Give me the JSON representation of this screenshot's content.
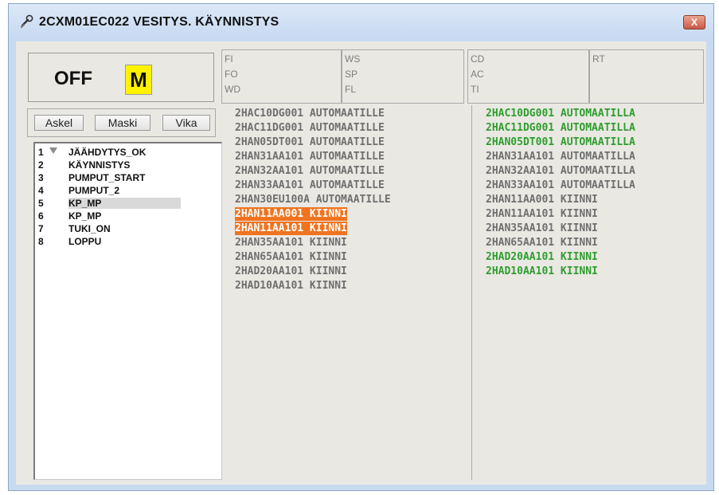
{
  "window": {
    "title": "2CXM01EC022 VESITYS. KÄYNNISTYS",
    "close_label": "X"
  },
  "status": {
    "state": "OFF",
    "mode": "M",
    "mode_color": "#fff200"
  },
  "params": [
    [
      "FI",
      "FO",
      "WD"
    ],
    [
      "WS",
      "SP",
      "FL"
    ],
    [
      "CD",
      "AC",
      "TI"
    ],
    [
      "RT"
    ]
  ],
  "buttons": {
    "step": "Askel",
    "mask": "Maski",
    "fault": "Vika"
  },
  "steps": [
    {
      "num": "1",
      "label": "JÄÄHDYTYS_OK"
    },
    {
      "num": "2",
      "label": "KÄYNNISTYS"
    },
    {
      "num": "3",
      "label": "PUMPUT_START"
    },
    {
      "num": "4",
      "label": "PUMPUT_2"
    },
    {
      "num": "5",
      "label": "KP_MP"
    },
    {
      "num": "6",
      "label": "KP_MP"
    },
    {
      "num": "7",
      "label": "TUKI_ON"
    },
    {
      "num": "8",
      "label": "LOPPU"
    }
  ],
  "conditions_left": [
    {
      "text": "2HAC10DG001 AUTOMAATILLE",
      "status": "gray"
    },
    {
      "text": "2HAC11DG001 AUTOMAATILLE",
      "status": "gray"
    },
    {
      "text": "2HAN05DT001 AUTOMAATILLE",
      "status": "gray"
    },
    {
      "text": "2HAN31AA101 AUTOMAATILLE",
      "status": "gray"
    },
    {
      "text": "2HAN32AA101 AUTOMAATILLE",
      "status": "gray"
    },
    {
      "text": "2HAN33AA101 AUTOMAATILLE",
      "status": "gray"
    },
    {
      "text": "2HAN30EU100A AUTOMAATILLE",
      "status": "gray"
    },
    {
      "text": "2HAN11AA001 KIINNI",
      "status": "orange"
    },
    {
      "text": "2HAN11AA101 KIINNI",
      "status": "orange"
    },
    {
      "text": "2HAN35AA101 KIINNI",
      "status": "gray"
    },
    {
      "text": "2HAN65AA101 KIINNI",
      "status": "gray"
    },
    {
      "text": "2HAD20AA101 KIINNI",
      "status": "gray"
    },
    {
      "text": "2HAD10AA101 KIINNI",
      "status": "gray"
    }
  ],
  "conditions_right": [
    {
      "text": "2HAC10DG001 AUTOMAATILLA",
      "status": "green"
    },
    {
      "text": "2HAC11DG001 AUTOMAATILLA",
      "status": "green"
    },
    {
      "text": "2HAN05DT001 AUTOMAATILLA",
      "status": "green"
    },
    {
      "text": "2HAN31AA101 AUTOMAATILLA",
      "status": "gray"
    },
    {
      "text": "2HAN32AA101 AUTOMAATILLA",
      "status": "gray"
    },
    {
      "text": "2HAN33AA101 AUTOMAATILLA",
      "status": "gray"
    },
    {
      "text": "2HAN11AA001 KIINNI",
      "status": "gray"
    },
    {
      "text": "2HAN11AA101 KIINNI",
      "status": "gray"
    },
    {
      "text": "2HAN35AA101 KIINNI",
      "status": "gray"
    },
    {
      "text": "2HAN65AA101 KIINNI",
      "status": "gray"
    },
    {
      "text": "2HAD20AA101 KIINNI",
      "status": "green"
    },
    {
      "text": "2HAD10AA101 KIINNI",
      "status": "green"
    }
  ],
  "colors": {
    "ok_green": "#2e9e2e",
    "fault_orange": "#f0731f",
    "inactive_gray": "#6f6f6f"
  }
}
